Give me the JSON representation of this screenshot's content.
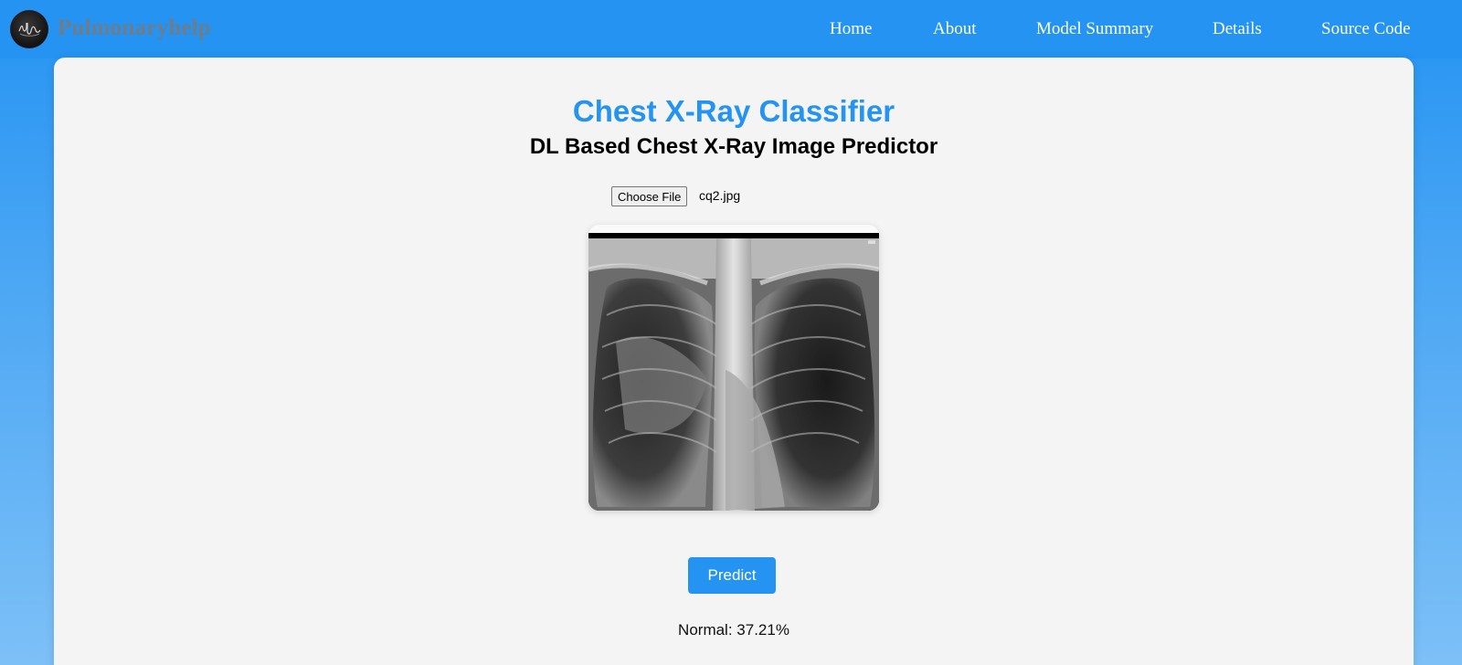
{
  "brand": {
    "name": "Pulmonaryhelp",
    "logo_icon": "lungs-logo-icon"
  },
  "nav": {
    "items": [
      {
        "label": "Home"
      },
      {
        "label": "About"
      },
      {
        "label": "Model Summary"
      },
      {
        "label": "Details"
      },
      {
        "label": "Source Code"
      }
    ]
  },
  "main": {
    "title": "Chest X-Ray Classifier",
    "subtitle": "DL Based Chest X-Ray Image Predictor",
    "file_input": {
      "button_label": "Choose File",
      "file_name": "cq2.jpg"
    },
    "predict_label": "Predict",
    "result": "Normal: 37.21%"
  },
  "colors": {
    "accent": "#2493f2",
    "brand_text": "#6f7c8a",
    "card_bg": "#f4f4f4"
  }
}
